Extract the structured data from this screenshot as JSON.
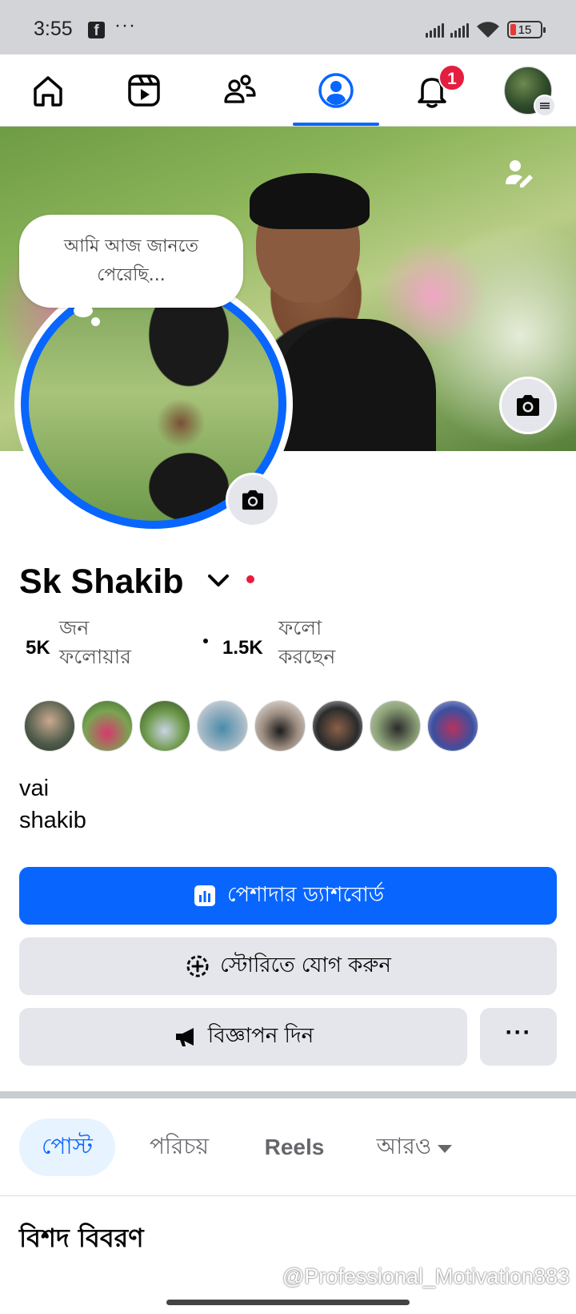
{
  "status_bar": {
    "time": "3:55",
    "app_icon": "facebook-f",
    "more": "···",
    "battery": "15",
    "battery_color": "#e53935"
  },
  "nav": {
    "items": [
      "home-icon",
      "reels-icon",
      "friends-icon",
      "profile-icon",
      "notifications-icon",
      "menu-avatar"
    ],
    "active": "profile",
    "notification_count": "1",
    "accent": "#0866ff"
  },
  "profile": {
    "note": "আমি আজ জানতে পেরেছি...",
    "name": "Sk Shakib",
    "followers": {
      "count": "5K",
      "label": "জন ফলোয়ার"
    },
    "following": {
      "count": "1.5K",
      "label": "ফলো করছেন"
    },
    "bio_line1": "vai",
    "bio_line2": "shakib"
  },
  "buttons": {
    "dashboard": "পেশাদার ড্যাশবোর্ড",
    "add_story": "স্টোরিতে যোগ করুন",
    "ads": "বিজ্ঞাপন দিন",
    "more": "···"
  },
  "tabs": {
    "posts": "পোস্ট",
    "about": "পরিচয়",
    "reels": "Reels",
    "more": "আরও"
  },
  "section": {
    "title": "বিশদ বিবরণ"
  },
  "watermark": "@Professional_Motivation883"
}
